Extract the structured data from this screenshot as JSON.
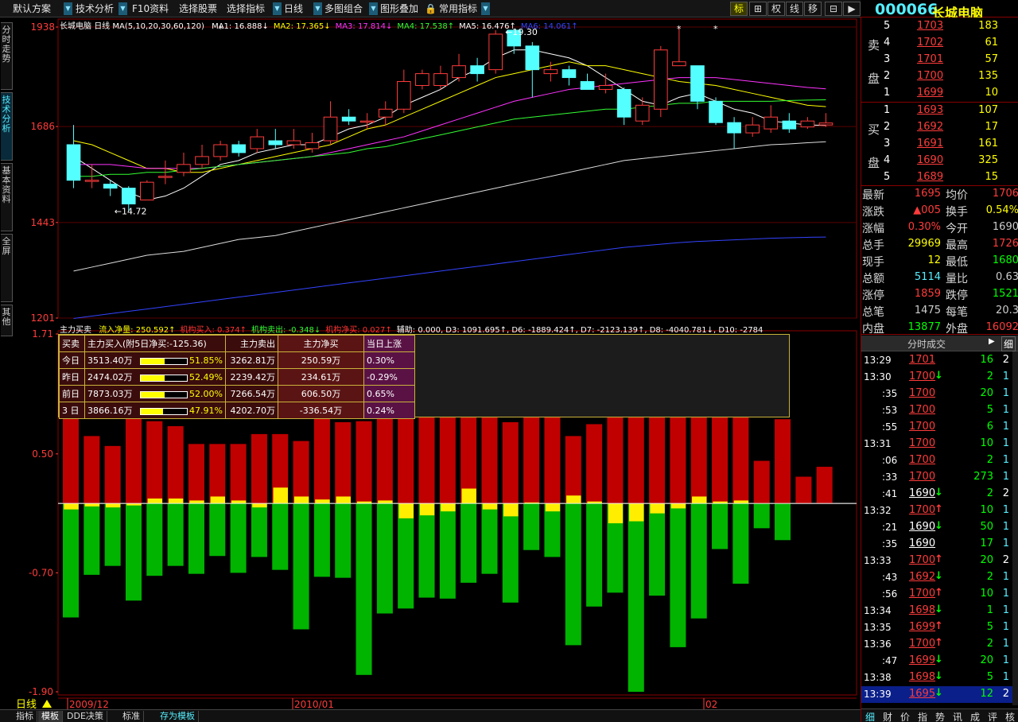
{
  "toolbar": {
    "items": [
      "默认方案",
      "技术分析",
      "F10资料",
      "选择股票",
      "选择指标",
      "日线",
      "多图组合",
      "图形叠加",
      "常用指标"
    ],
    "icons": [
      "标",
      "⊞",
      "权",
      "线",
      "移",
      "⊟",
      "▶"
    ]
  },
  "stock": {
    "code": "000066",
    "name": "长城电脑"
  },
  "side_tabs": [
    "分时走势",
    "技术分析",
    "基本资料",
    "全屏",
    "其他"
  ],
  "kline": {
    "name": "长城电脑",
    "period": "日线",
    "ma_params": "MA(5,10,20,30,60,120)",
    "ma": [
      {
        "label": "MA1: 16.888↓",
        "color": "#ffffff"
      },
      {
        "label": "MA2: 17.365↓",
        "color": "#ffff00"
      },
      {
        "label": "MA3: 17.814↓",
        "color": "#ff33ff"
      },
      {
        "label": "MA4: 17.538↑",
        "color": "#33ff33"
      },
      {
        "label": "MA5: 16.476↑",
        "color": "#ffffff"
      },
      {
        "label": "MA6: 14.061↑",
        "color": "#3344ff"
      }
    ],
    "y_ticks": [
      "1938",
      "1686",
      "1443",
      "1201"
    ],
    "high_label": "19.30",
    "low_label": "14.72"
  },
  "indicator": {
    "title": "主力买卖",
    "items": [
      {
        "label": "流入净量: 250.592↑",
        "color": "#ffff00"
      },
      {
        "label": "机构买入: 0.374↑",
        "color": "#ff3333"
      },
      {
        "label": "机构卖出: -0.348↓",
        "color": "#33ff33"
      },
      {
        "label": "机构净买: 0.027↑",
        "color": "#ff3333"
      },
      {
        "label": "辅助: 0.000, D3: 1091.695↑, D6: -1889.424↑, D7: -2123.139↑, D8: -4040.781↓, D10: -2784",
        "color": "#ffffff"
      }
    ],
    "y_ticks": [
      "1.71",
      "0.50",
      "-0.70",
      "-1.90"
    ]
  },
  "panel": {
    "headers": [
      "买卖",
      "主力买入(附5日净买:-125.36)",
      "主力卖出",
      "主力净买",
      "当日上涨"
    ],
    "rows": [
      {
        "label": "今日",
        "buy": "3513.40万",
        "pct": "51.85%",
        "pctv": 0.5185,
        "sell": "3262.81万",
        "net": "250.59万",
        "up": "0.30%"
      },
      {
        "label": "昨日",
        "buy": "2474.02万",
        "pct": "52.49%",
        "pctv": 0.5249,
        "sell": "2239.42万",
        "net": "234.61万",
        "up": "-0.29%"
      },
      {
        "label": "前日",
        "buy": "7873.03万",
        "pct": "52.00%",
        "pctv": 0.52,
        "sell": "7266.54万",
        "net": "606.50万",
        "up": "0.65%"
      },
      {
        "label": "3 日",
        "buy": "3866.16万",
        "pct": "47.91%",
        "pctv": 0.4791,
        "sell": "4202.70万",
        "net": "-336.54万",
        "up": "0.24%"
      }
    ]
  },
  "xaxis": {
    "period_label": "日线",
    "dates": [
      "2009/12",
      "2010/01",
      "02"
    ]
  },
  "bottom_tabs": [
    "指标",
    "模板",
    "DDE决策",
    "标准",
    "存为模板"
  ],
  "orderbook": {
    "sell_label": [
      "卖",
      "盘"
    ],
    "buy_label": [
      "买",
      "盘"
    ],
    "sells": [
      {
        "lvl": "5",
        "price": "1703",
        "vol": "183"
      },
      {
        "lvl": "4",
        "price": "1702",
        "vol": "61"
      },
      {
        "lvl": "3",
        "price": "1701",
        "vol": "57"
      },
      {
        "lvl": "2",
        "price": "1700",
        "vol": "135"
      },
      {
        "lvl": "1",
        "price": "1699",
        "vol": "10"
      }
    ],
    "buys": [
      {
        "lvl": "1",
        "price": "1693",
        "vol": "107"
      },
      {
        "lvl": "2",
        "price": "1692",
        "vol": "17"
      },
      {
        "lvl": "3",
        "price": "1691",
        "vol": "161"
      },
      {
        "lvl": "4",
        "price": "1690",
        "vol": "325"
      },
      {
        "lvl": "5",
        "price": "1689",
        "vol": "15"
      }
    ]
  },
  "quote": [
    {
      "l1": "最新",
      "v1": "1695",
      "c1": "red",
      "l2": "均价",
      "v2": "1706",
      "c2": "red"
    },
    {
      "l1": "涨跌",
      "v1": "▲005",
      "c1": "red",
      "l2": "换手",
      "v2": "0.54%",
      "c2": "yel"
    },
    {
      "l1": "涨幅",
      "v1": "0.30%",
      "c1": "red",
      "l2": "今开",
      "v2": "1690",
      "c2": "gry"
    },
    {
      "l1": "总手",
      "v1": "29969",
      "c1": "yel",
      "l2": "最高",
      "v2": "1726",
      "c2": "red"
    },
    {
      "l1": "现手",
      "v1": "12",
      "c1": "yel",
      "l2": "最低",
      "v2": "1680",
      "c2": "grn"
    },
    {
      "l1": "总额",
      "v1": "5114",
      "c1": "cy",
      "l2": "量比",
      "v2": "0.63",
      "c2": "gry"
    },
    {
      "l1": "涨停",
      "v1": "1859",
      "c1": "red",
      "l2": "跌停",
      "v2": "1521",
      "c2": "grn"
    },
    {
      "l1": "总笔",
      "v1": "1475",
      "c1": "gry",
      "l2": "每笔",
      "v2": "20.3",
      "c2": "gry"
    },
    {
      "l1": "内盘",
      "v1": "13877",
      "c1": "grn",
      "l2": "外盘",
      "v2": "16092",
      "c2": "red"
    }
  ],
  "trades_header": "分时成交",
  "trades_btn": "细",
  "trades": [
    {
      "t": "13:29",
      "p": "1701",
      "d": "",
      "v": "16",
      "n": "2",
      "pc": "red"
    },
    {
      "t": "13:30",
      "p": "1700",
      "d": "↓",
      "v": "2",
      "n": "1",
      "pc": "red"
    },
    {
      "t": ":35",
      "p": "1700",
      "d": "",
      "v": "20",
      "n": "1",
      "pc": "red"
    },
    {
      "t": ":53",
      "p": "1700",
      "d": "",
      "v": "5",
      "n": "1",
      "pc": "red"
    },
    {
      "t": ":55",
      "p": "1700",
      "d": "",
      "v": "6",
      "n": "1",
      "pc": "red"
    },
    {
      "t": "13:31",
      "p": "1700",
      "d": "",
      "v": "10",
      "n": "1",
      "pc": "red"
    },
    {
      "t": ":06",
      "p": "1700",
      "d": "",
      "v": "2",
      "n": "1",
      "pc": "red"
    },
    {
      "t": ":33",
      "p": "1700",
      "d": "",
      "v": "273",
      "n": "1",
      "pc": "red"
    },
    {
      "t": ":41",
      "p": "1690",
      "d": "↓",
      "v": "2",
      "n": "2",
      "pc": "wht"
    },
    {
      "t": "13:32",
      "p": "1700",
      "d": "↑",
      "v": "10",
      "n": "1",
      "pc": "red"
    },
    {
      "t": ":21",
      "p": "1690",
      "d": "↓",
      "v": "50",
      "n": "1",
      "pc": "wht"
    },
    {
      "t": ":35",
      "p": "1690",
      "d": "",
      "v": "17",
      "n": "1",
      "pc": "wht"
    },
    {
      "t": "13:33",
      "p": "1700",
      "d": "↑",
      "v": "20",
      "n": "2",
      "pc": "red"
    },
    {
      "t": ":43",
      "p": "1692",
      "d": "↓",
      "v": "2",
      "n": "1",
      "pc": "red"
    },
    {
      "t": ":56",
      "p": "1700",
      "d": "↑",
      "v": "10",
      "n": "1",
      "pc": "red"
    },
    {
      "t": "13:34",
      "p": "1698",
      "d": "↓",
      "v": "1",
      "n": "1",
      "pc": "red"
    },
    {
      "t": "13:35",
      "p": "1699",
      "d": "↑",
      "v": "5",
      "n": "1",
      "pc": "red"
    },
    {
      "t": "13:36",
      "p": "1700",
      "d": "↑",
      "v": "2",
      "n": "1",
      "pc": "red"
    },
    {
      "t": ":47",
      "p": "1699",
      "d": "↓",
      "v": "20",
      "n": "1",
      "pc": "red"
    },
    {
      "t": "13:38",
      "p": "1698",
      "d": "↓",
      "v": "5",
      "n": "1",
      "pc": "red"
    },
    {
      "t": "13:39",
      "p": "1695",
      "d": "↓",
      "v": "12",
      "n": "2",
      "pc": "red"
    }
  ],
  "right_bottom_tabs": [
    "细",
    "财",
    "价",
    "指",
    "势",
    "讯",
    "成",
    "评",
    "核"
  ],
  "chart_data": [
    {
      "type": "candlestick",
      "title": "长城电脑 日线",
      "ylim": [
        12.01,
        19.38
      ],
      "y_ticks": [
        19.38,
        16.86,
        14.43,
        12.01
      ],
      "candles": [
        [
          16.4,
          16.9,
          15.5,
          15.3
        ],
        [
          15.5,
          15.9,
          15.5,
          15.3
        ],
        [
          15.4,
          15.5,
          15.3,
          15.1
        ],
        [
          15.3,
          15.35,
          14.9,
          14.72
        ],
        [
          15.0,
          15.5,
          15.45,
          15.0
        ],
        [
          15.6,
          16.0,
          15.6,
          15.4
        ],
        [
          15.7,
          16.2,
          15.9,
          15.6
        ],
        [
          15.9,
          16.4,
          16.1,
          15.8
        ],
        [
          16.1,
          16.5,
          16.4,
          16.0
        ],
        [
          16.4,
          16.5,
          16.2,
          16.1
        ],
        [
          16.3,
          16.8,
          16.6,
          16.2
        ],
        [
          16.5,
          16.8,
          16.4,
          16.3
        ],
        [
          16.4,
          16.8,
          16.5,
          16.3
        ],
        [
          16.3,
          16.7,
          16.45,
          16.2
        ],
        [
          16.5,
          17.5,
          17.1,
          16.4
        ],
        [
          17.1,
          17.3,
          17.0,
          16.9
        ],
        [
          17.0,
          17.2,
          17.0,
          16.8
        ],
        [
          17.1,
          17.5,
          17.3,
          16.9
        ],
        [
          17.3,
          18.3,
          18.0,
          17.2
        ],
        [
          17.9,
          18.3,
          18.2,
          17.8
        ],
        [
          17.9,
          18.4,
          18.2,
          17.8
        ],
        [
          18.1,
          18.7,
          18.4,
          18.0
        ],
        [
          18.4,
          18.6,
          18.2,
          18.0
        ],
        [
          18.3,
          19.3,
          19.2,
          18.2
        ],
        [
          19.3,
          19.3,
          18.9,
          18.7
        ],
        [
          18.9,
          19.0,
          18.3,
          17.6
        ],
        [
          18.2,
          18.5,
          18.3,
          18.0
        ],
        [
          18.3,
          18.4,
          18.1,
          17.9
        ],
        [
          18.0,
          18.2,
          17.8,
          17.8
        ],
        [
          17.8,
          18.2,
          17.9,
          17.7
        ],
        [
          17.8,
          17.85,
          17.1,
          16.9
        ],
        [
          17.0,
          17.6,
          17.4,
          16.9
        ],
        [
          17.3,
          18.9,
          18.8,
          17.1
        ],
        [
          18.4,
          19.38,
          18.5,
          18.4
        ],
        [
          18.4,
          18.4,
          17.5,
          17.3
        ],
        [
          17.5,
          17.6,
          16.96,
          16.9
        ],
        [
          16.96,
          17.1,
          16.7,
          16.3
        ],
        [
          16.7,
          17.1,
          16.9,
          16.6
        ],
        [
          16.8,
          17.4,
          17.1,
          16.7
        ],
        [
          17.0,
          17.2,
          16.8,
          16.7
        ],
        [
          16.85,
          17.1,
          17.0,
          16.8
        ],
        [
          16.9,
          17.2,
          16.95,
          16.85
        ]
      ],
      "ma": {
        "MA1": [
          16.1,
          15.8,
          15.5,
          15.2,
          15.0,
          15.1,
          15.3,
          15.6,
          15.9,
          16.0,
          16.2,
          16.3,
          16.4,
          16.4,
          16.6,
          16.8,
          16.9,
          17.1,
          17.4,
          17.6,
          17.8,
          18.1,
          18.3,
          18.6,
          18.8,
          18.8,
          18.7,
          18.6,
          18.4,
          18.1,
          17.8,
          17.5,
          17.4,
          17.6,
          17.7,
          17.5,
          17.3,
          17.2,
          17.0,
          16.95,
          16.9,
          16.888
        ],
        "MA2": [
          16.5,
          16.4,
          16.2,
          16.0,
          15.8,
          15.8,
          15.7,
          15.7,
          15.8,
          15.9,
          16.0,
          16.1,
          16.2,
          16.3,
          16.4,
          16.6,
          16.8,
          16.9,
          17.1,
          17.3,
          17.5,
          17.7,
          17.9,
          18.1,
          18.2,
          18.3,
          18.4,
          18.5,
          18.4,
          18.4,
          18.3,
          18.2,
          18.1,
          18.0,
          17.95,
          17.9,
          17.8,
          17.7,
          17.6,
          17.5,
          17.4,
          17.365
        ],
        "MA3": [
          15.9,
          15.9,
          15.9,
          15.85,
          15.8,
          15.8,
          15.8,
          15.8,
          15.85,
          15.9,
          15.95,
          16.0,
          16.05,
          16.1,
          16.2,
          16.3,
          16.4,
          16.5,
          16.6,
          16.75,
          16.9,
          17.05,
          17.2,
          17.35,
          17.5,
          17.6,
          17.7,
          17.8,
          17.85,
          17.9,
          17.95,
          18.0,
          18.05,
          18.1,
          18.1,
          18.1,
          18.05,
          18.0,
          17.95,
          17.9,
          17.85,
          17.814
        ],
        "MA4": [
          15.6,
          15.6,
          15.65,
          15.65,
          15.7,
          15.7,
          15.75,
          15.8,
          15.85,
          15.9,
          15.95,
          16.0,
          16.05,
          16.1,
          16.15,
          16.2,
          16.3,
          16.35,
          16.45,
          16.55,
          16.65,
          16.75,
          16.85,
          16.95,
          17.05,
          17.1,
          17.15,
          17.2,
          17.25,
          17.3,
          17.3,
          17.35,
          17.4,
          17.45,
          17.45,
          17.5,
          17.5,
          17.5,
          17.5,
          17.52,
          17.53,
          17.538
        ],
        "MA5": [
          13.2,
          13.3,
          13.4,
          13.5,
          13.6,
          13.65,
          13.7,
          13.8,
          13.9,
          14.0,
          14.05,
          14.1,
          14.2,
          14.3,
          14.4,
          14.5,
          14.6,
          14.7,
          14.8,
          14.9,
          15.0,
          15.1,
          15.2,
          15.3,
          15.4,
          15.5,
          15.6,
          15.7,
          15.8,
          15.9,
          16.0,
          16.05,
          16.1,
          16.15,
          16.2,
          16.25,
          16.3,
          16.35,
          16.4,
          16.42,
          16.45,
          16.476
        ],
        "MA6": [
          12.0,
          12.06,
          12.12,
          12.18,
          12.24,
          12.3,
          12.36,
          12.42,
          12.48,
          12.54,
          12.6,
          12.66,
          12.72,
          12.78,
          12.84,
          12.9,
          12.96,
          13.02,
          13.08,
          13.14,
          13.2,
          13.26,
          13.32,
          13.38,
          13.44,
          13.5,
          13.56,
          13.62,
          13.68,
          13.74,
          13.8,
          13.84,
          13.88,
          13.92,
          13.95,
          13.97,
          13.99,
          14.01,
          14.03,
          14.045,
          14.055,
          14.061
        ]
      }
    },
    {
      "type": "bar",
      "title": "主力买卖",
      "ylim": [
        -1.9,
        1.71
      ],
      "y_ticks": [
        1.71,
        0.5,
        -0.7,
        -1.9
      ],
      "series": [
        {
          "name": "机构买入",
          "values": [
            1.1,
            0.68,
            0.58,
            0.92,
            0.83,
            0.78,
            0.6,
            0.6,
            0.6,
            0.7,
            0.7,
            0.63,
            0.9,
            0.82,
            0.83,
            1.0,
            1.1,
            1.15,
            0.95,
            0.92,
            1.12,
            0.82,
            1.15,
            0.92,
            0.68,
            0.8,
            1.3,
            1.1,
            1.1,
            1.7,
            0.9,
            1.26,
            1.06,
            0.43,
            0.85,
            0.27,
            0.37
          ]
        },
        {
          "name": "机构卖出",
          "values": [
            -1.15,
            -0.72,
            -0.63,
            -0.98,
            -0.73,
            -0.63,
            -0.71,
            -0.53,
            -0.7,
            -0.54,
            -0.67,
            -1.27,
            -0.74,
            -0.75,
            -1.73,
            -1.11,
            -1.06,
            -0.95,
            -0.96,
            -0.8,
            -0.71,
            -1.0,
            -0.47,
            -0.54,
            -1.43,
            -1.04,
            -0.9,
            -1.9,
            -0.93,
            -1.45,
            -1.16,
            -0.46,
            -0.81,
            -0.25,
            -0.37
          ]
        },
        {
          "name": "流入净量",
          "values": [
            -0.06,
            -0.03,
            -0.04,
            -0.02,
            0.05,
            0.05,
            0.03,
            0.07,
            0.03,
            -0.04,
            0.16,
            0.07,
            0.04,
            0.07,
            0.02,
            0.03,
            -0.15,
            -0.12,
            -0.08,
            0.15,
            -0.06,
            -0.13,
            0.01,
            -0.08,
            0.08,
            0.02,
            -0.2,
            -0.18,
            -0.1,
            -0.05,
            0.07,
            0.02,
            0.03
          ]
        }
      ]
    }
  ]
}
